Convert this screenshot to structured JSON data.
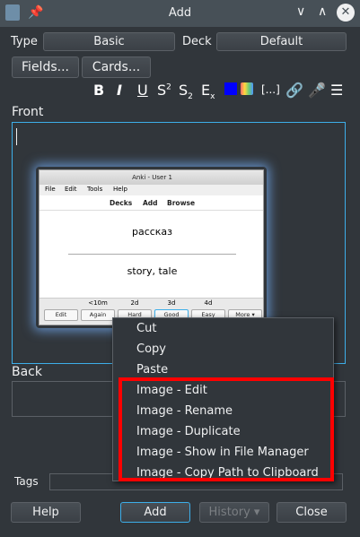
{
  "window": {
    "title": "Add"
  },
  "toolbar": {
    "type_label": "Type",
    "type_value": "Basic",
    "deck_label": "Deck",
    "deck_value": "Default",
    "fields_label": "Fields...",
    "cards_label": "Cards..."
  },
  "format": {
    "bold": "B",
    "italic": "I",
    "underline": "U",
    "superscript": "S",
    "superscript_mark": "2",
    "subscript": "S",
    "subscript_mark": "2",
    "clear": "E",
    "clear_mark": "x",
    "cloze": "[...]",
    "text_color": "#0000ff"
  },
  "fields": {
    "front_label": "Front",
    "back_label": "Back",
    "tags_label": "Tags"
  },
  "embedded_image": {
    "window_title": "Anki - User 1",
    "menu": [
      "File",
      "Edit",
      "Tools",
      "Help"
    ],
    "toolbar": [
      "Decks",
      "Add",
      "Browse"
    ],
    "question": "рассказ",
    "answer": "story, tale",
    "times": [
      "<10m",
      "2d",
      "3d",
      "4d"
    ],
    "buttons": [
      "Edit",
      "Again",
      "Hard",
      "Good",
      "Easy",
      "More ▾"
    ]
  },
  "context_menu": {
    "items": [
      "Cut",
      "Copy",
      "Paste",
      "Image - Edit",
      "Image - Rename",
      "Image - Duplicate",
      "Image - Show in File Manager",
      "Image - Copy Path to Clipboard"
    ]
  },
  "buttons": {
    "help": "Help",
    "add": "Add",
    "history": "History ▾",
    "close": "Close"
  }
}
